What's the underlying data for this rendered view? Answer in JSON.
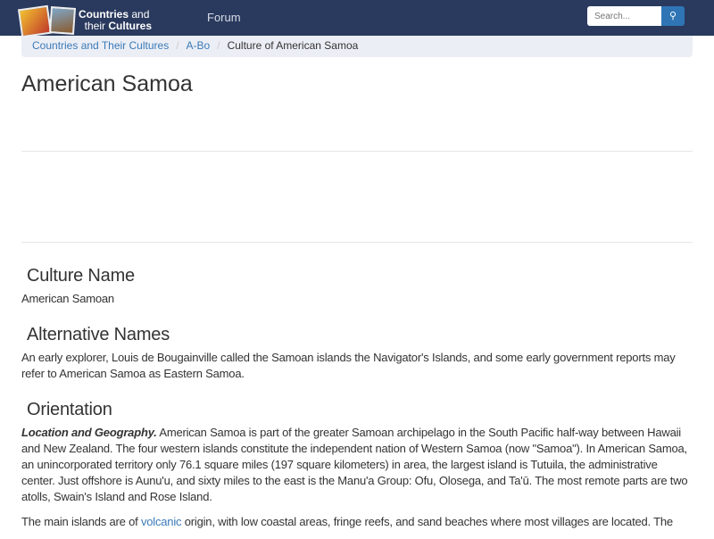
{
  "header": {
    "logo_line1_bold": "Countries",
    "logo_line1": " and",
    "logo_line2": "their ",
    "logo_line2_bold": "Cultures",
    "forum": "Forum",
    "search_placeholder": "Search...",
    "search_icon": "magnifier"
  },
  "breadcrumb": [
    "Countries and Their Cultures",
    "A-Bo",
    "Culture of American Samoa"
  ],
  "page_title": "American Samoa",
  "sections": {
    "culture_name": {
      "heading": "Culture Name",
      "text": "American Samoan"
    },
    "alt_names": {
      "heading": "Alternative Names",
      "text": "An early explorer, Louis de Bougainville called the Samoan islands the Navigator's Islands, and some early government reports may refer to American Samoa as Eastern Samoa."
    },
    "orientation": {
      "heading": "Orientation",
      "lead": "Location and Geography.",
      "text": " American Samoa is part of the greater Samoan archipelago in the South Pacific half-way between Hawaii and New Zealand. The four western islands constitute the independent nation of Western Samoa (now \"Samoa\"). In American Samoa, an unincorporated territory only 76.1 square miles (197 square kilometers) in area, the largest island is Tutuila, the administrative center. Just offshore is Aunu'u, and sixty miles to the east is the Manu'a Group: Ofu, Olosega, and Ta'ū. The most remote parts are two atolls, Swain's Island and Rose Island.",
      "p2_start": "The main islands are of ",
      "p2_link": "volcanic",
      "p2_end": " origin, with low coastal areas, fringe reefs, and sand beaches where most villages are located. The"
    }
  }
}
